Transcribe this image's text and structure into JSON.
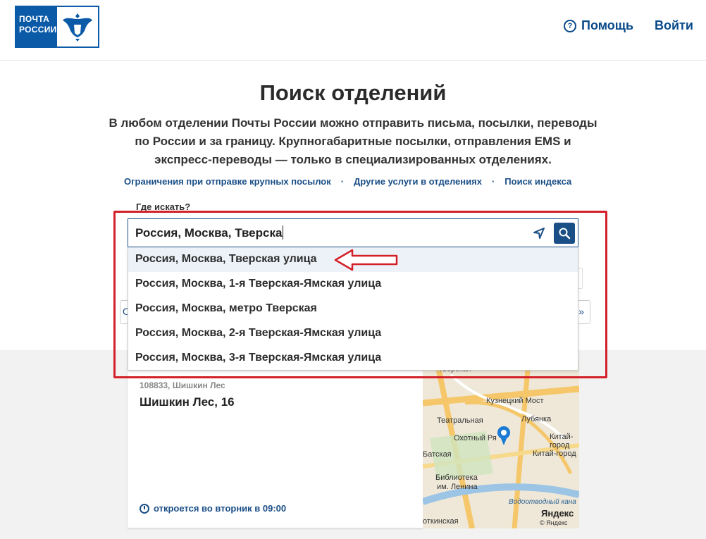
{
  "header": {
    "logo_line1": "ПОЧТА",
    "logo_line2": "РОССИИ",
    "help_label": "Помощь",
    "login_label": "Войти"
  },
  "main": {
    "title": "Поиск отделений",
    "description": "В любом отделении Почты России можно отправить письма, посылки, переводы по России и за границу. Крупногабаритные посылки, отправления EMS и экспресс-переводы — только в специализированных отделениях.",
    "links": [
      "Ограничения при отправке крупных посылок",
      "Другие услуги в отделениях",
      "Поиск индекса"
    ],
    "link_separator": "·",
    "search_label": "Где искать?"
  },
  "search": {
    "value": "Россия, Москва, Тверска",
    "suggestions": [
      "Россия, Москва, Тверская улица",
      "Россия, Москва, 1-я Тверская-Ямская улица",
      "Россия, Москва, метро Тверская",
      "Россия, Москва, 2-я Тверская-Ямская улица",
      "Россия, Москва, 3-я Тверская-Ямская улица"
    ],
    "hidden_button_left": "О",
    "hidden_button_right": "»"
  },
  "result": {
    "index_line": "108833, Шишкин Лес",
    "name": "Шишкин Лес, 16",
    "hours": "откроется во вторник в 09:00"
  },
  "map": {
    "labels": [
      "Тверская",
      "Кузнецкий Мост",
      "Театральная",
      "Лубянка",
      "Охотный Ря",
      "Китай-город",
      "Китай-город",
      "Батская",
      "Библиотека",
      "им. Ленина",
      "Яндекс",
      "© Яндекс",
      "откинская",
      "Водоотводный кана"
    ]
  },
  "colors": {
    "brand_blue": "#0a5aa8",
    "link_blue": "#1a4e86",
    "highlight_red": "#d42028"
  }
}
